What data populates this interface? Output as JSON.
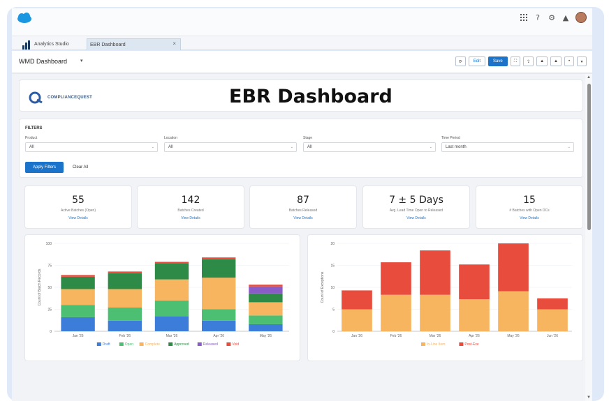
{
  "topbar": {
    "icons": [
      "app-grid-icon",
      "help-icon",
      "settings-icon",
      "bell-icon",
      "avatar"
    ]
  },
  "tabs": [
    {
      "label": "Analytics Studio"
    },
    {
      "label": "EBR Dashboard",
      "close": "×"
    }
  ],
  "header": {
    "title": "WMD Dashboard",
    "caret": "▾",
    "toolbar": {
      "edit_label": "Edit",
      "save_label": "Save"
    }
  },
  "banner": {
    "logo_text": "COMPLIANCEQUEST",
    "title": "EBR Dashboard"
  },
  "filters": {
    "title": "FILTERS",
    "fields": [
      {
        "label": "Product",
        "value": "All"
      },
      {
        "label": "Location",
        "value": "All"
      },
      {
        "label": "Stage",
        "value": "All"
      },
      {
        "label": "Time Period",
        "value": "Last month"
      }
    ],
    "apply_label": "Apply Filters",
    "clear_label": "Clear All"
  },
  "kpis": [
    {
      "value": "55",
      "label": "Active Batches (Open)",
      "link": "View Details"
    },
    {
      "value": "142",
      "label": "Batches Created",
      "link": "View Details"
    },
    {
      "value": "87",
      "label": "Batches Released",
      "link": "View Details"
    },
    {
      "value": "7 ± 5 Days",
      "label": "Avg. Lead Time Open to Released",
      "link": "View Details"
    },
    {
      "value": "15",
      "label": "# Batches with Open DCs",
      "link": "View Details"
    }
  ],
  "chart_data": [
    {
      "type": "bar",
      "stacked": true,
      "categories": [
        "Jan '26",
        "Feb '26",
        "Mar '26",
        "Apr '26",
        "May '26"
      ],
      "ylabel": "Count of Batch Records",
      "ylim": [
        0,
        100
      ],
      "yticks": [
        0,
        25,
        50,
        75,
        100
      ],
      "legend_position": "bottom",
      "series": [
        {
          "name": "Draft",
          "color": "#3b7dd8",
          "values": [
            16,
            12,
            17,
            12,
            8
          ]
        },
        {
          "name": "Open",
          "color": "#4cbf73",
          "values": [
            14,
            15,
            18,
            13,
            10
          ]
        },
        {
          "name": "Complete",
          "color": "#f6b55e",
          "values": [
            18,
            21,
            24,
            36,
            15
          ]
        },
        {
          "name": "Approved",
          "color": "#2e8b47",
          "values": [
            14,
            18,
            18,
            21,
            10
          ]
        },
        {
          "name": "Released",
          "color": "#8a5cc7",
          "values": [
            0,
            0,
            0,
            0,
            8
          ]
        },
        {
          "name": "Void",
          "color": "#e84c3d",
          "values": [
            2,
            2,
            2,
            2,
            2
          ]
        }
      ]
    },
    {
      "type": "bar",
      "stacked": true,
      "categories": [
        "Jan '26",
        "Feb '26",
        "Mar '26",
        "Apr '26",
        "May '26",
        "Jun '26"
      ],
      "ylabel": "Count of Exceptions",
      "ylim": [
        0,
        20
      ],
      "yticks": [
        0,
        5,
        10,
        15,
        20
      ],
      "legend_position": "bottom",
      "series": [
        {
          "name": "In-Line Item",
          "color": "#f6b55e",
          "values": [
            5,
            8.3,
            8.3,
            7.3,
            9.1,
            5
          ]
        },
        {
          "name": "Post-Exe",
          "color": "#e84c3d",
          "values": [
            4.3,
            7.4,
            10.1,
            7.9,
            10.9,
            2.5
          ]
        }
      ]
    }
  ]
}
